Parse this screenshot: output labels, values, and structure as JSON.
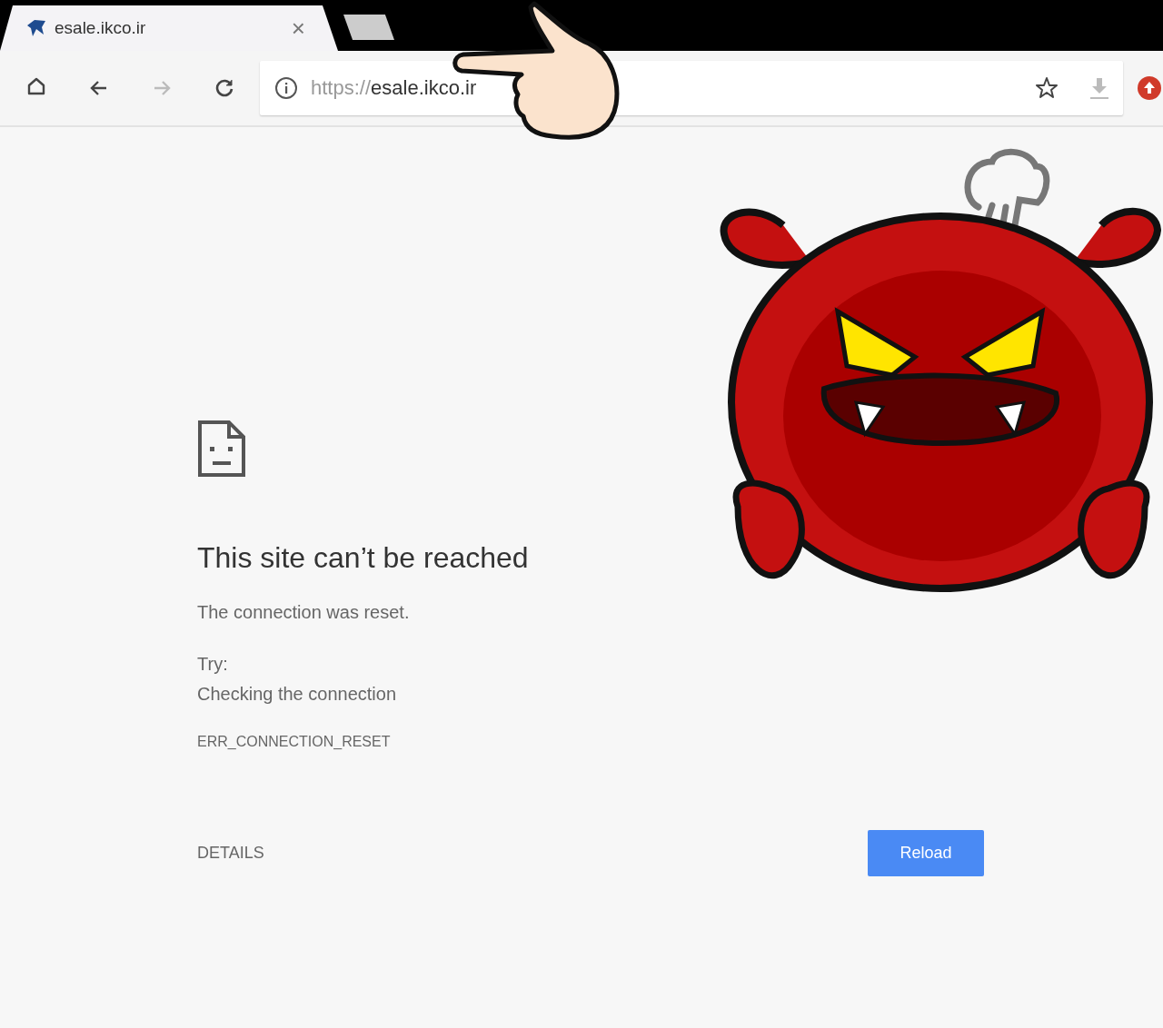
{
  "tab": {
    "title": "esale.ikco.ir",
    "close": "×"
  },
  "toolbar": {
    "buttons": [
      {
        "kind": "home",
        "disabled": false
      },
      {
        "kind": "back",
        "disabled": false
      },
      {
        "kind": "forward",
        "disabled": true
      },
      {
        "kind": "reload",
        "disabled": false
      }
    ]
  },
  "address_bar": {
    "scheme": "https://",
    "host": "esale.ikco.ir"
  },
  "error": {
    "title": "This site can’t be reached",
    "message": "The connection was reset.",
    "try_label": "Try:",
    "suggestion": "Checking the connection",
    "code": "ERR_CONNECTION_RESET",
    "details": "DETAILS",
    "reload": "Reload"
  }
}
